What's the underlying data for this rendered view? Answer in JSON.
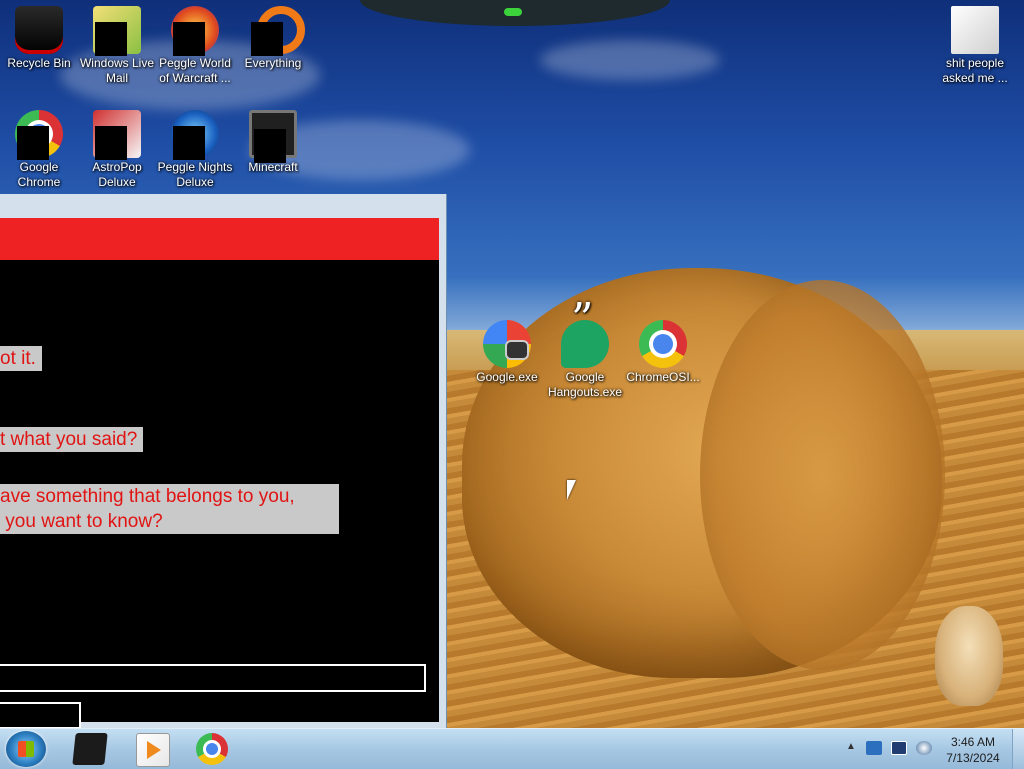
{
  "desktop": {
    "icons_left": [
      {
        "label": "Recycle Bin",
        "icon": "recycle-bin-icon"
      },
      {
        "label": "Windows Live Mail",
        "icon": "mail-icon"
      },
      {
        "label": "Peggle World of Warcraft ...",
        "icon": "peggle-icon"
      },
      {
        "label": "Everything",
        "icon": "everything-icon"
      },
      {
        "label": "Google Chrome",
        "icon": "chrome-icon"
      },
      {
        "label": "AstroPop Deluxe",
        "icon": "astropop-icon"
      },
      {
        "label": "Peggle Nights Deluxe",
        "icon": "peggle-nights-icon"
      },
      {
        "label": "Minecraft",
        "icon": "minecraft-icon"
      }
    ],
    "icons_right": [
      {
        "label": "shit people asked me ...",
        "icon": "folder-icon"
      }
    ],
    "icons_middle": [
      {
        "label": "Google.exe",
        "icon": "google-exe-icon"
      },
      {
        "label": "Google Hangouts.exe",
        "icon": "hangouts-icon"
      },
      {
        "label": "ChromeOSI...",
        "icon": "chrome-icon"
      }
    ]
  },
  "app_window": {
    "messages": [
      "ot it.",
      "t what you said?",
      "ave something that belongs to you,\n you want to know?"
    ],
    "colors": {
      "bar": "#ee2222",
      "text": "#e11414",
      "bubble": "#c9c9c9"
    }
  },
  "taskbar": {
    "apps": [
      {
        "name": "dark-app",
        "icon": "app-icon"
      },
      {
        "name": "media-player",
        "icon": "media-player-icon"
      },
      {
        "name": "chrome",
        "icon": "chrome-icon"
      }
    ],
    "clock": {
      "time": "3:46 AM",
      "date": "7/13/2024"
    },
    "tray_arrow": "▲"
  }
}
